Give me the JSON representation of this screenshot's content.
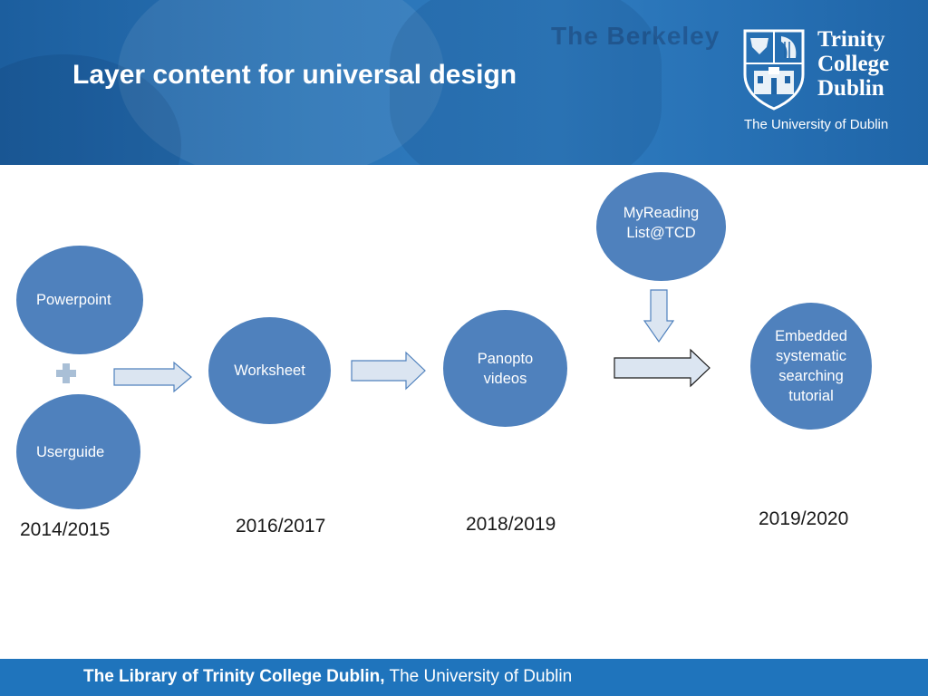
{
  "header": {
    "title": "Layer content for universal design",
    "background_sign_text": "The Berkeley",
    "logo": {
      "name_lines": [
        "Trinity",
        "College",
        "Dublin"
      ],
      "subtitle": "The University of Dublin"
    }
  },
  "diagram": {
    "stages": [
      {
        "year": "2014/2015",
        "items": [
          "Powerpoint",
          "Userguide"
        ],
        "connector": "plus"
      },
      {
        "year": "2016/2017",
        "items": [
          "Worksheet"
        ]
      },
      {
        "year": "2018/2019",
        "items": [
          "Panopto\nvideos"
        ]
      },
      {
        "year": "2019/2020",
        "items": [
          "Embedded\nsystematic\nsearching\ntutorial"
        ],
        "input_from": "MyReading\nList@TCD"
      }
    ]
  },
  "footer": {
    "bold": "The Library of Trinity College Dublin,",
    "regular": " The University of Dublin"
  },
  "colors": {
    "header_blue": "#2a74b6",
    "node_fill": "#4f81bd",
    "arrow_fill": "#dbe5f1",
    "arrow_stroke": "#4f81bd",
    "footer_blue": "#1f74bc"
  }
}
